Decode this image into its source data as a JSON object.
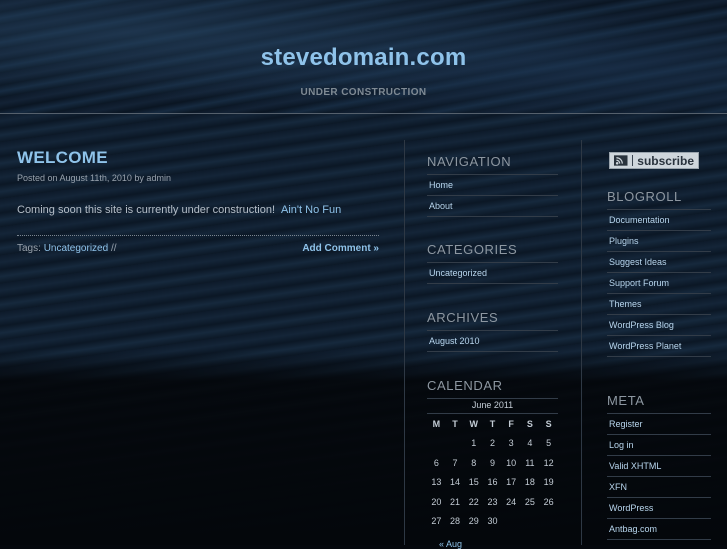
{
  "site": {
    "title": "stevedomain.com",
    "description": "UNDER CONSTRUCTION"
  },
  "post": {
    "title": "WELCOME",
    "meta": "Posted on August 11th, 2010 by admin",
    "body": "Coming soon this site is currently under construction!",
    "body_link": "Ain't No Fun",
    "tags_label": "Tags:",
    "tag": "Uncategorized",
    "tags_suffix": "//",
    "add_comment": "Add Comment »"
  },
  "navigation": {
    "heading": "NAVIGATION",
    "items": [
      "Home",
      "About"
    ]
  },
  "categories": {
    "heading": "CATEGORIES",
    "items": [
      "Uncategorized"
    ]
  },
  "archives": {
    "heading": "ARCHIVES",
    "items": [
      "August 2010"
    ]
  },
  "calendar": {
    "heading": "CALENDAR",
    "caption": "June 2011",
    "weekdays": [
      "M",
      "T",
      "W",
      "T",
      "F",
      "S",
      "S"
    ],
    "weeks": [
      [
        "",
        "",
        "1",
        "2",
        "3",
        "4",
        "5"
      ],
      [
        "6",
        "7",
        "8",
        "9",
        "10",
        "11",
        "12"
      ],
      [
        "13",
        "14",
        "15",
        "16",
        "17",
        "18",
        "19"
      ],
      [
        "20",
        "21",
        "22",
        "23",
        "24",
        "25",
        "26"
      ],
      [
        "27",
        "28",
        "29",
        "30",
        "",
        "",
        ""
      ]
    ],
    "prev": "« Aug"
  },
  "subscribe": {
    "label": "subscribe",
    "icon": "rss-icon"
  },
  "blogroll": {
    "heading": "BLOGROLL",
    "items": [
      "Documentation",
      "Plugins",
      "Suggest Ideas",
      "Support Forum",
      "Themes",
      "WordPress Blog",
      "WordPress Planet"
    ]
  },
  "meta": {
    "heading": "META",
    "items": [
      "Register",
      "Log in",
      "Valid XHTML",
      "XFN",
      "WordPress",
      "Antbag.com"
    ]
  },
  "colors": {
    "accent": "#8fc3ea",
    "text": "#b9c2cc",
    "background": "#05080d"
  }
}
